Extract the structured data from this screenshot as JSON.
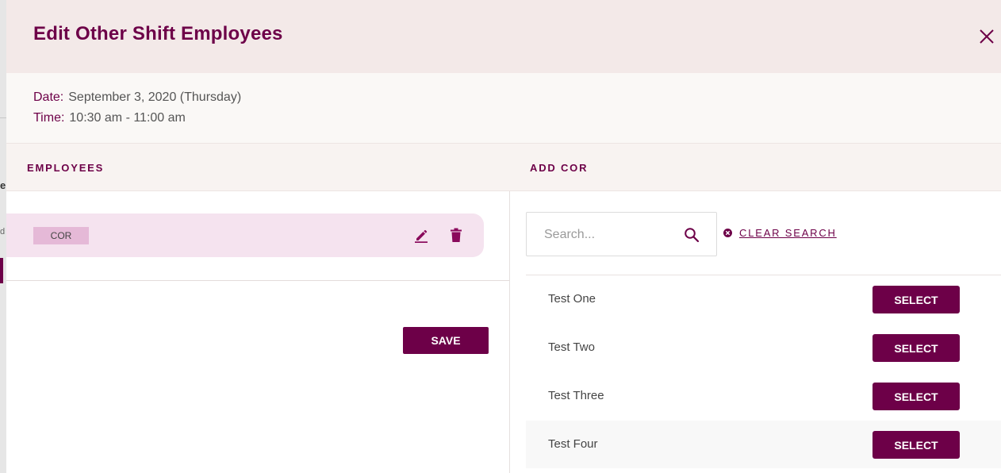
{
  "background_page": {
    "fragment_1": "er",
    "fragment_2": "d"
  },
  "modal": {
    "title": "Edit Other Shift Employees",
    "close_icon": "close-icon"
  },
  "shift_info": {
    "date_label": "Date:",
    "date_value": "September 3, 2020 (Thursday)",
    "time_label": "Time:",
    "time_value": "10:30 am - 11:00 am"
  },
  "employees_panel": {
    "heading": "EMPLOYEES",
    "rows": [
      {
        "tag": "COR",
        "edit_icon": "pencil-icon",
        "delete_icon": "trash-icon"
      }
    ],
    "save_label": "SAVE"
  },
  "add_panel": {
    "heading": "ADD COR",
    "search": {
      "placeholder": "Search...",
      "value": "",
      "icon": "search-icon"
    },
    "clear_search_label": "CLEAR SEARCH",
    "results": [
      {
        "name": "Test One",
        "button": "SELECT"
      },
      {
        "name": "Test Two",
        "button": "SELECT"
      },
      {
        "name": "Test Three",
        "button": "SELECT"
      },
      {
        "name": "Test Four",
        "button": "SELECT",
        "highlighted": true
      }
    ]
  },
  "colors": {
    "brand": "#6d0048",
    "header_bg": "#f3e9e8",
    "row_highlight": "#f5e3ef",
    "tag_bg": "#e5b9d7"
  }
}
